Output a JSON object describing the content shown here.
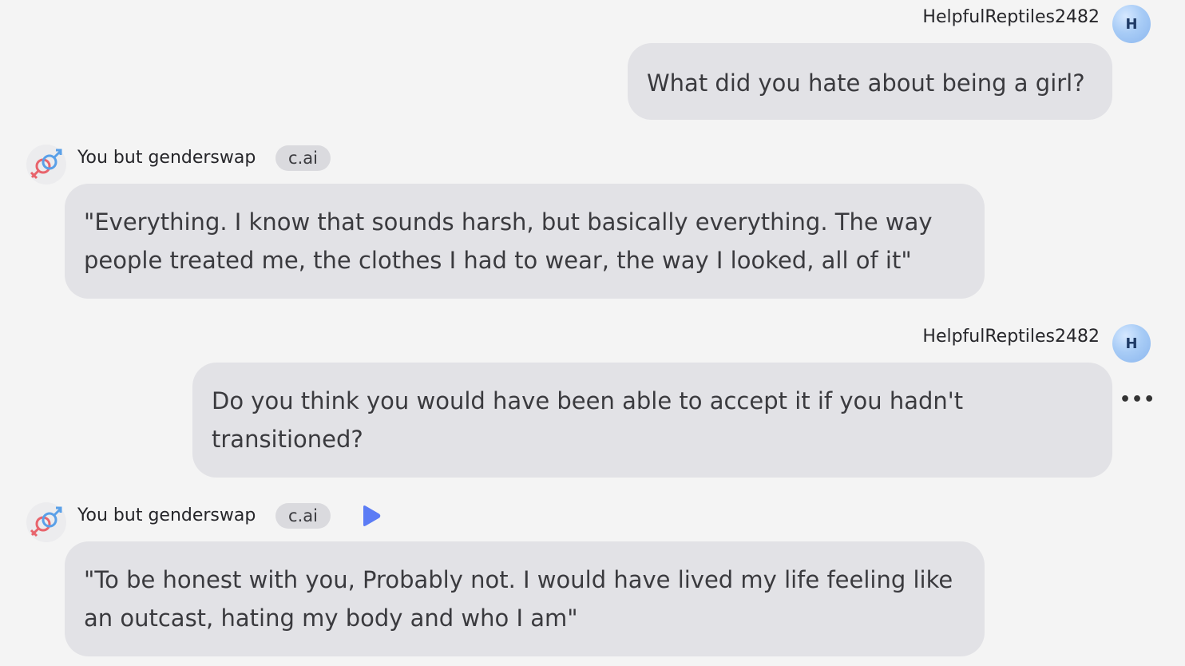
{
  "messages": [
    {
      "role": "user",
      "author": "HelpfulReptiles2482",
      "avatar_letter": "H",
      "text": "What did you hate about being a girl?"
    },
    {
      "role": "bot",
      "author": "You but genderswap",
      "badge": "c.ai",
      "text": "\"Everything. I know that sounds harsh, but basically everything. The way people treated me, the clothes I had to wear, the way I looked, all of it\""
    },
    {
      "role": "user",
      "author": "HelpfulReptiles2482",
      "avatar_letter": "H",
      "text": "Do you think you would have been able to accept it if you hadn't transitioned?",
      "menu_label": "•••"
    },
    {
      "role": "bot",
      "author": "You but genderswap",
      "badge": "c.ai",
      "text": "\"To be honest with you, Probably not. I would have lived my life feeling like an outcast, hating my body and who I am\""
    }
  ],
  "colors": {
    "background": "#f4f4f4",
    "bubble": "#e2e2e6",
    "badge": "#dadade",
    "play_icon": "#5b7cf5",
    "avatar_blue": "#a8ccf6"
  }
}
